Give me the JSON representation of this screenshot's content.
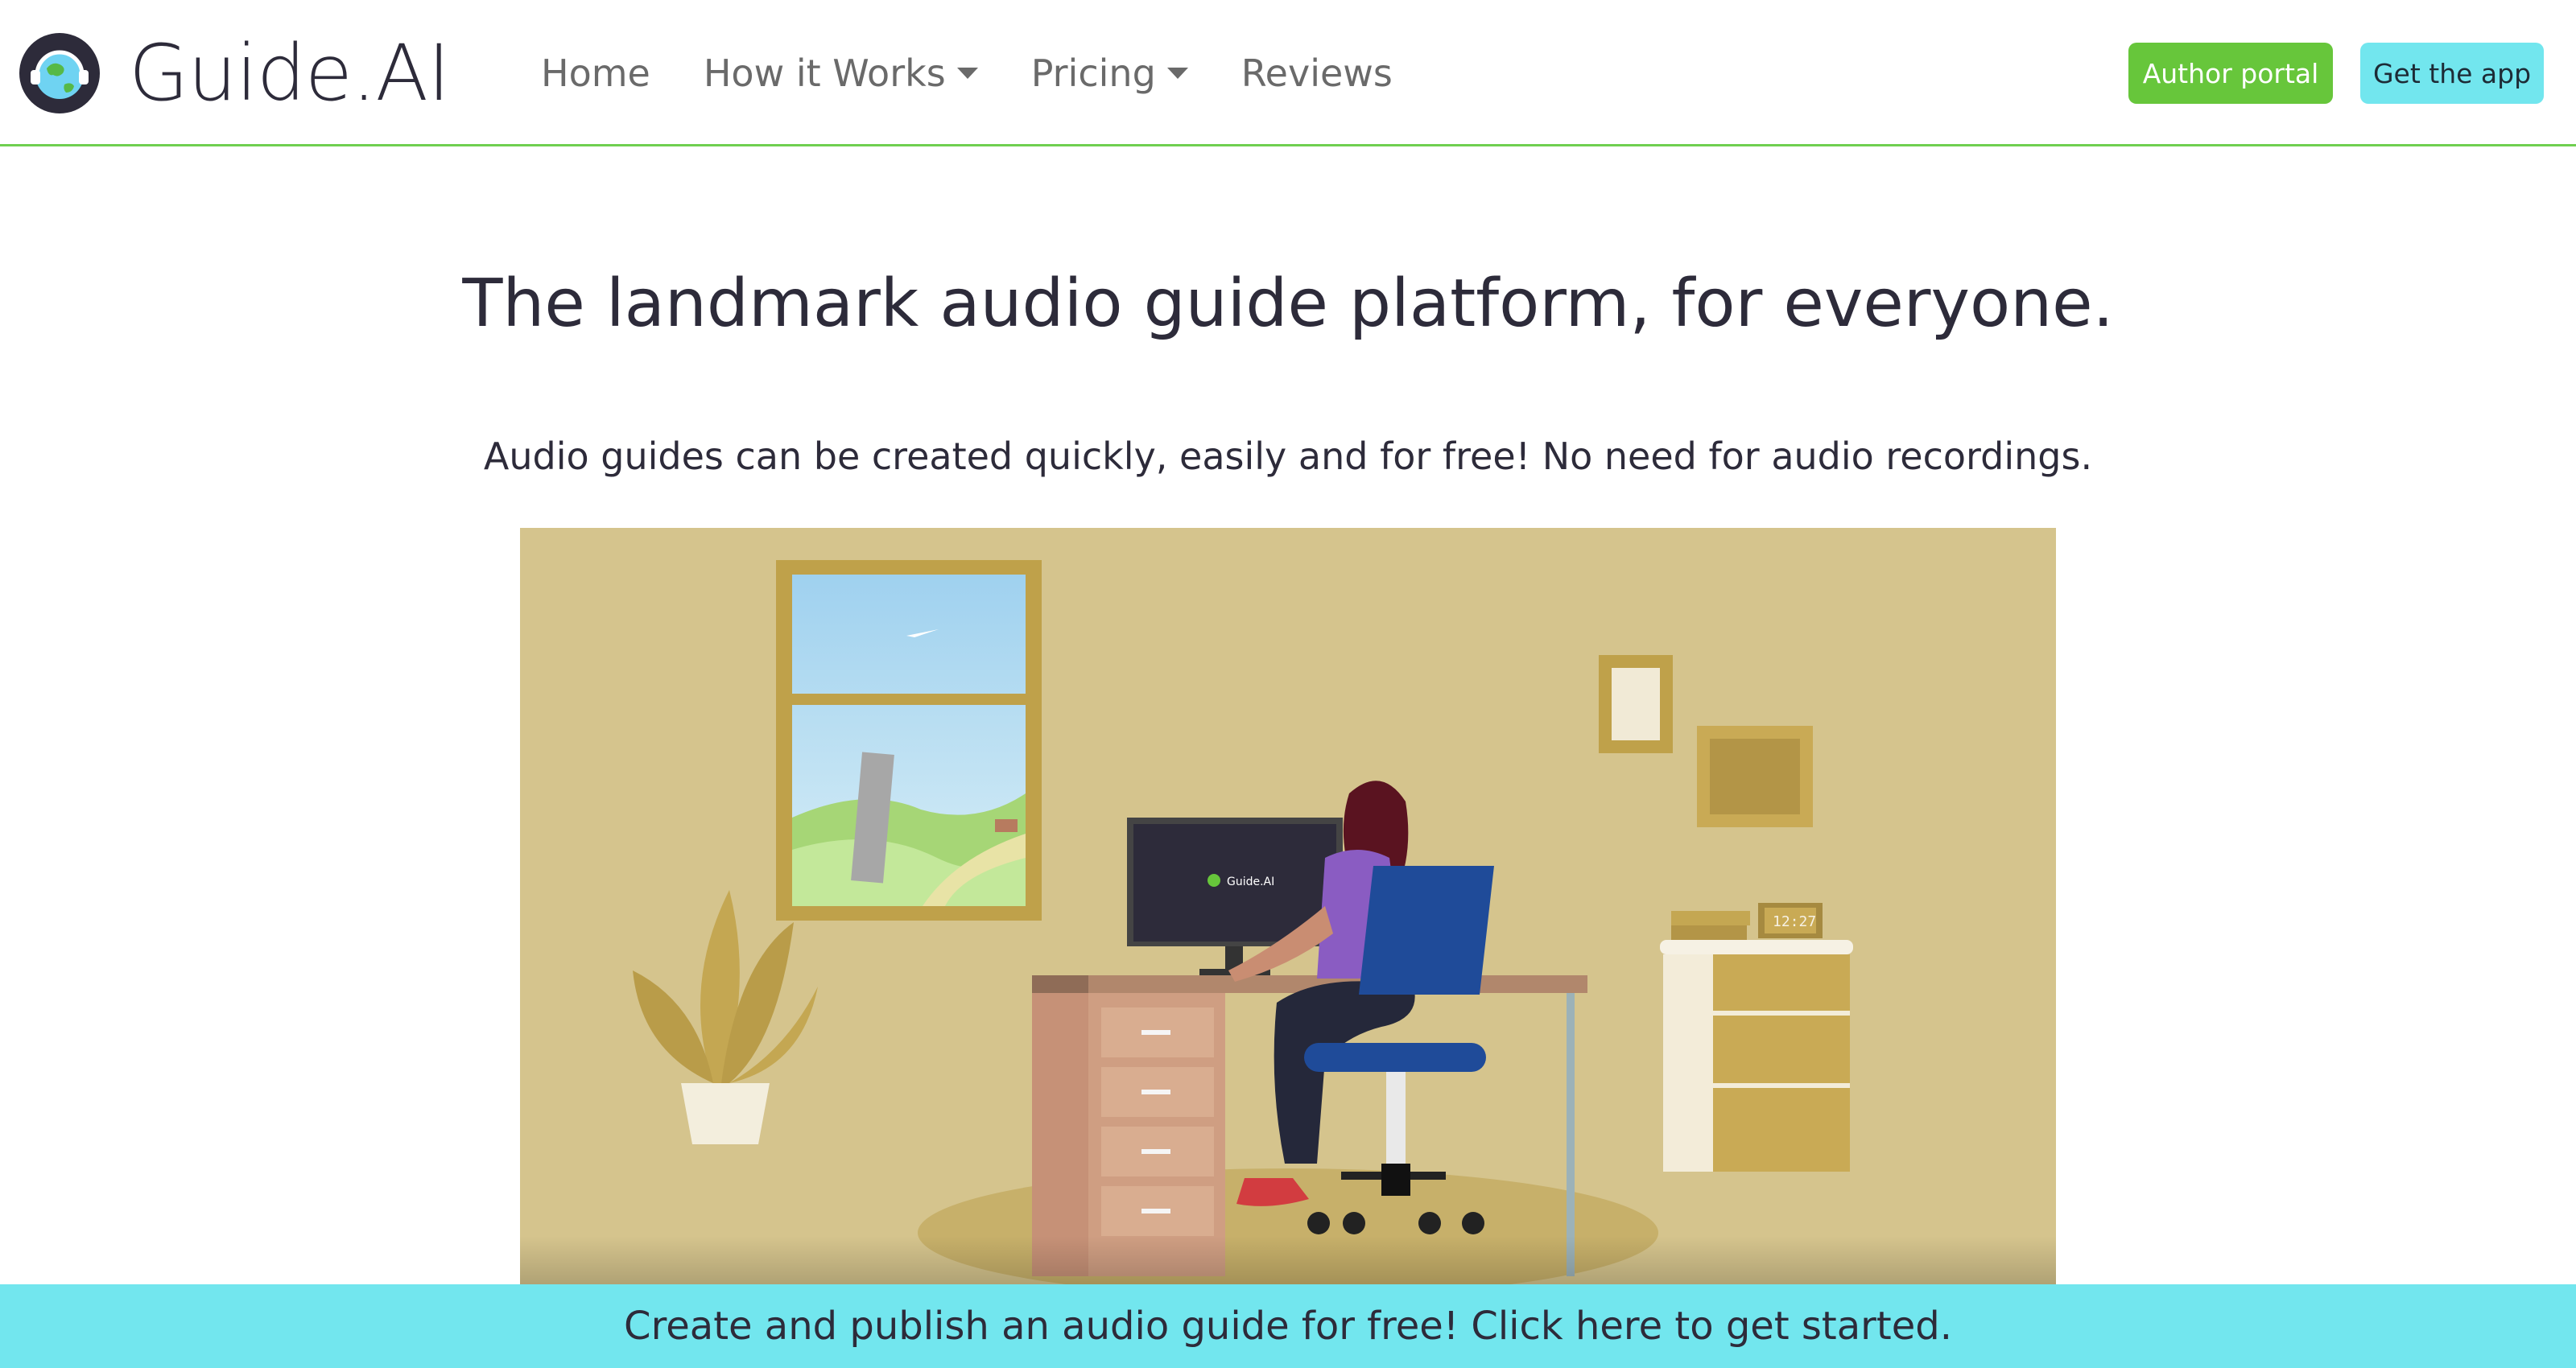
{
  "brand": {
    "name": "Guide.AI",
    "logo_icon": "globe-headphones-icon"
  },
  "nav": {
    "items": [
      {
        "label": "Home",
        "has_dropdown": false
      },
      {
        "label": "How it Works",
        "has_dropdown": true
      },
      {
        "label": "Pricing",
        "has_dropdown": true
      },
      {
        "label": "Reviews",
        "has_dropdown": false
      }
    ]
  },
  "actions": {
    "author_portal": "Author portal",
    "get_app": "Get the app"
  },
  "hero": {
    "title": "The landmark audio guide platform, for everyone.",
    "subtitle": "Audio guides can be created quickly, easily and for free! No need for audio recordings."
  },
  "illustration": {
    "screen_brand": "Guide.AI",
    "clock_time": "12:27"
  },
  "banner": {
    "text": "Create and publish an audio guide for free! Click here to get started."
  },
  "colors": {
    "accent_green": "#67c63b",
    "accent_cyan": "#72e6ee",
    "text_dark": "#2d2b3a",
    "wall": "#d5c48d"
  }
}
